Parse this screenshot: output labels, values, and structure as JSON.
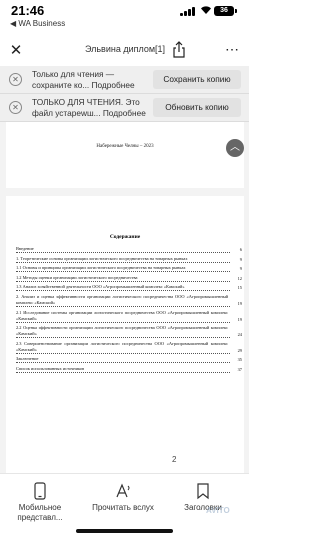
{
  "status_bar": {
    "time": "21:46",
    "back_app": "◀ WA Business",
    "battery": "36"
  },
  "toolbar": {
    "title": "Эльвина диплом[1]",
    "close_icon": "close-icon",
    "share_icon": "share-icon",
    "more_icon": "more-icon"
  },
  "banners": [
    {
      "line1": "Только для чтения —",
      "line2": "сохраните ко... Подробнее",
      "button": "Сохранить копию"
    },
    {
      "line1": "ТОЛЬКО ДЛЯ ЧТЕНИЯ. Это",
      "line2": "файл устареwш... Подробнее",
      "button": "Обновить копию"
    }
  ],
  "document": {
    "page1_footer": "Набережные Челны – 2023",
    "contents_title": "Содержание",
    "toc": [
      {
        "text": "Введение",
        "page": "6"
      },
      {
        "text": "1. Теоретические основы организации логистического посредничества на товарных рынках",
        "page": "9"
      },
      {
        "text": "1.1 Основы и принципы организации логистического посредничества на товарных рынках",
        "page": "9"
      },
      {
        "text": "1.2 Методы оценки организации логистического посредничества",
        "page": "12"
      },
      {
        "text": "1.3 Анализ хозяйственной деятельности ООО «Агропромышленный комплекс «Камский»",
        "page": "15"
      },
      {
        "text": "2. Анализ и оценка эффективности организации логистического посредничества ООО «Агропромышленный комплекс «Камский»",
        "page": "19"
      },
      {
        "text": "2.1 Исследование системы организации логистического посредничества ООО «Агропромышленный комплекс «Камский»",
        "page": "19"
      },
      {
        "text": "2.2 Оценка эффективности организации логистического посредничества ООО «Агропромышленный комплекс «Камский»",
        "page": "24"
      },
      {
        "text": "2.3 Совершенствование организации логистического посредничества ООО «Агропромышленный комплекс «Камский»",
        "page": "29"
      },
      {
        "text": "Заключение",
        "page": "35"
      },
      {
        "text": "Список использованных источников",
        "page": "37"
      }
    ],
    "page_indicator": "2"
  },
  "bottom_bar": {
    "mobile_view": "Мобильное представл...",
    "read_aloud": "Прочитать вслух",
    "headings": "Заголовки",
    "watermark": "AVITO"
  }
}
